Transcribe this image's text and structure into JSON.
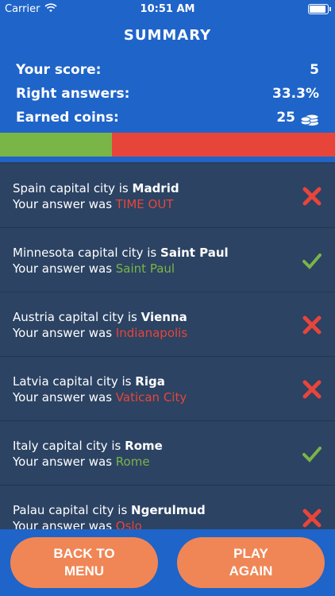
{
  "status_bar": {
    "carrier": "Carrier",
    "time": "10:51 AM"
  },
  "summary": {
    "title": "SUMMARY",
    "score_label": "Your score:",
    "score_value": "5",
    "right_label": "Right answers:",
    "right_value": "33.3%",
    "coins_label": "Earned coins:",
    "coins_value": "25",
    "coins_icon": "coins-stack-icon",
    "right_fraction": 0.333
  },
  "colors": {
    "primary": "#1f64c8",
    "correct": "#7ab548",
    "wrong": "#e8453a",
    "button": "#f08656",
    "list_bg": "#2c4363"
  },
  "answers": [
    {
      "prefix": "Spain capital city is ",
      "capital": "Madrid",
      "answer_prefix": "Your answer was ",
      "answer": "TIME OUT",
      "correct": false
    },
    {
      "prefix": "Minnesota capital city is ",
      "capital": "Saint Paul",
      "answer_prefix": "Your answer was ",
      "answer": "Saint Paul",
      "correct": true
    },
    {
      "prefix": "Austria capital city is ",
      "capital": "Vienna",
      "answer_prefix": "Your answer was ",
      "answer": "Indianapolis",
      "correct": false
    },
    {
      "prefix": "Latvia capital city is ",
      "capital": "Riga",
      "answer_prefix": "Your answer was ",
      "answer": "Vatican City",
      "correct": false
    },
    {
      "prefix": "Italy capital city is ",
      "capital": "Rome",
      "answer_prefix": "Your answer was ",
      "answer": "Rome",
      "correct": true
    },
    {
      "prefix": "Palau capital city is ",
      "capital": "Ngerulmud",
      "answer_prefix": "Your answer was ",
      "answer": "Oslo",
      "correct": false
    }
  ],
  "footer": {
    "back_label": "BACK TO\nMENU",
    "play_label": "PLAY\nAGAIN"
  }
}
